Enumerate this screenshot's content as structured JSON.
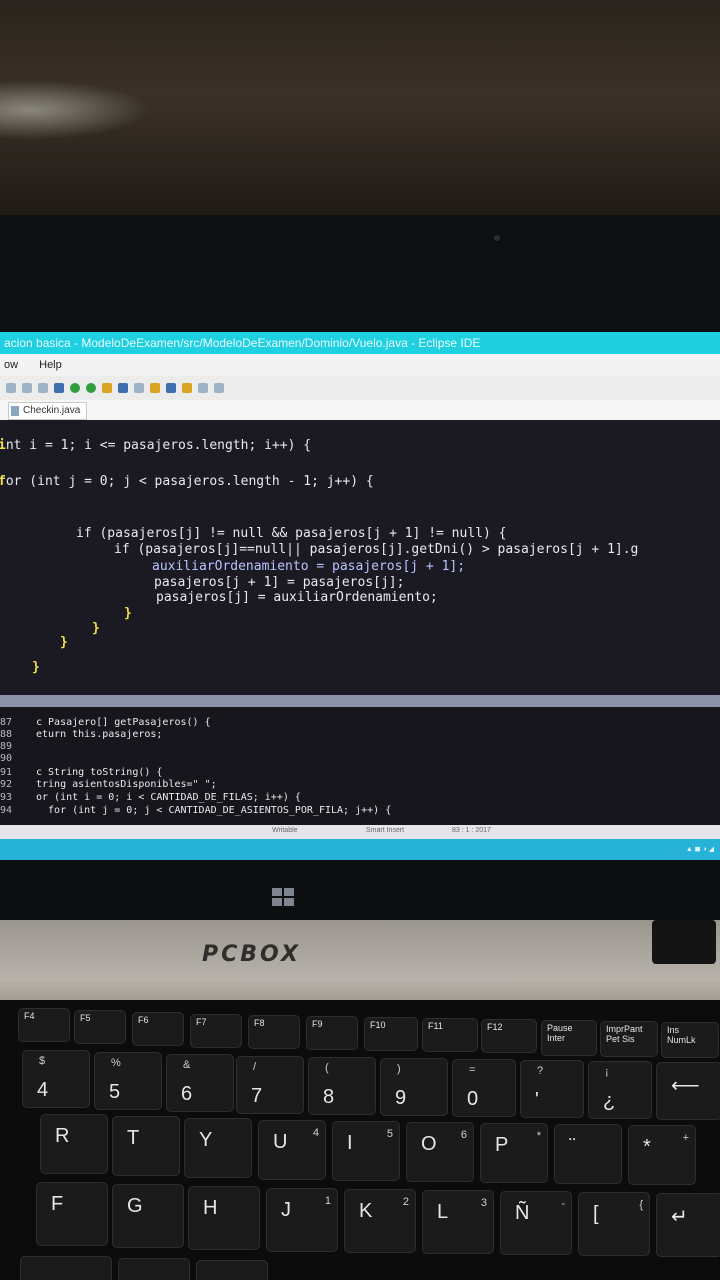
{
  "window": {
    "title": "acion basica - ModeloDeExamen/src/ModeloDeExamen/Dominio/Vuelo.java - Eclipse IDE",
    "menu": [
      "ow",
      "Help"
    ],
    "tab": "Checkin.java"
  },
  "editor": {
    "line1": "nt i = 1; i <= pasajeros.length; i++) {",
    "line2": "or (int j = 0; j < pasajeros.length - 1; j++) {",
    "line3": "if (pasajeros[j] != null && pasajeros[j + 1] != null) {",
    "line4": "if (pasajeros[j]==null|| pasajeros[j].getDni() > pasajeros[j + 1].g",
    "line5": "auxiliarOrdenamiento = pasajeros[j + 1];",
    "line6": "pasajeros[j + 1] = pasajeros[j];",
    "line7": "pasajeros[j] = auxiliarOrdenamiento;",
    "close1": "}",
    "close2": "}",
    "close3": "}",
    "close4": "}"
  },
  "lower_editor": {
    "line_numbers": [
      "87",
      "88",
      "89",
      "90",
      "91",
      "92",
      "93",
      "94"
    ],
    "lines": [
      "c Pasajero[] getPasajeros() {",
      "eturn this.pasajeros;",
      "",
      "",
      "c String toString() {",
      "tring asientosDisponibles=\" \";",
      "or (int i = 0; i < CANTIDAD_DE_FILAS; i++) {",
      "  for (int j = 0; j < CANTIDAD_DE_ASIENTOS_POR_FILA; j++) {"
    ]
  },
  "statusbar": {
    "mode": "Writable",
    "insert": "Smart Insert",
    "position": "83 : 1 : 2017"
  },
  "laptop": {
    "brand": "PCBOX"
  },
  "keyboard": {
    "fkeys": [
      "F4",
      "F5",
      "F6",
      "F7",
      "F8",
      "F9",
      "F10",
      "F11",
      "F12"
    ],
    "fn_extra": [
      "Pause\nInter",
      "ImprPant\nPet Sis",
      "Ins\nNumLk"
    ],
    "number_row": [
      {
        "main": "4",
        "shift": "$"
      },
      {
        "main": "5",
        "shift": "%"
      },
      {
        "main": "6",
        "shift": "&"
      },
      {
        "main": "7",
        "shift": "/"
      },
      {
        "main": "8",
        "shift": "("
      },
      {
        "main": "9",
        "shift": ")"
      },
      {
        "main": "0",
        "shift": "="
      },
      {
        "main": "'",
        "shift": "?"
      },
      {
        "main": "¿",
        "shift": "¡"
      }
    ],
    "row_r": [
      {
        "main": "R",
        "num": ""
      },
      {
        "main": "T",
        "num": ""
      },
      {
        "main": "Y",
        "num": ""
      },
      {
        "main": "U",
        "num": "4"
      },
      {
        "main": "I",
        "num": "5"
      },
      {
        "main": "O",
        "num": "6"
      },
      {
        "main": "P",
        "num": "*"
      },
      {
        "main": "¨",
        "num": ""
      },
      {
        "main": "*",
        "num": "+"
      }
    ],
    "row_f": [
      {
        "main": "F",
        "num": ""
      },
      {
        "main": "G",
        "num": ""
      },
      {
        "main": "H",
        "num": ""
      },
      {
        "main": "J",
        "num": "1"
      },
      {
        "main": "K",
        "num": "2"
      },
      {
        "main": "L",
        "num": "3"
      },
      {
        "main": "Ñ",
        "num": "-"
      },
      {
        "main": "[",
        "num": "{"
      }
    ]
  }
}
